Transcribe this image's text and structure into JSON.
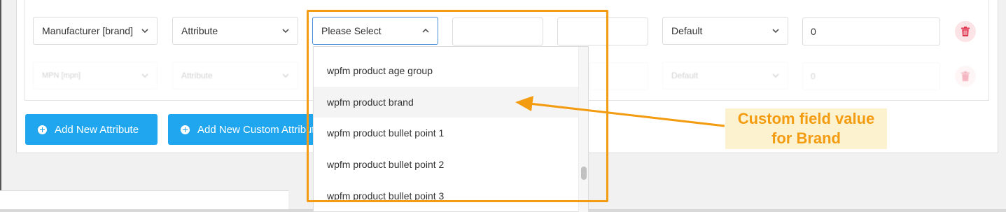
{
  "row1": {
    "field_select": "Manufacturer [brand]",
    "type_select": "Attribute",
    "value_select": "Please Select",
    "prefix_value": "",
    "suffix_value": "",
    "output_select": "Default",
    "limit_value": "0"
  },
  "row2": {
    "field_select": "MPN [mpn]",
    "type_select": "Attribute",
    "output_select": "Default",
    "limit_value": "0"
  },
  "buttons": {
    "add_attribute": "Add New Attribute",
    "add_custom_attribute": "Add New Custom Attribute"
  },
  "dropdown": {
    "options": [
      "wpfm product age group",
      "wpfm product brand",
      "wpfm product bullet point 1",
      "wpfm product bullet point 2",
      "wpfm product bullet point 3"
    ],
    "highlighted_index": 1
  },
  "annotation": {
    "line1": "Custom field value",
    "line2": "for Brand"
  },
  "colors": {
    "primary_button": "#20a6ef",
    "annotation_orange": "#f39c12",
    "annotation_bg": "#fdf2d0",
    "delete_icon": "#e0344f"
  },
  "icons": [
    "chevron-down-icon",
    "chevron-up-icon",
    "trash-icon",
    "plus-circle-icon"
  ]
}
